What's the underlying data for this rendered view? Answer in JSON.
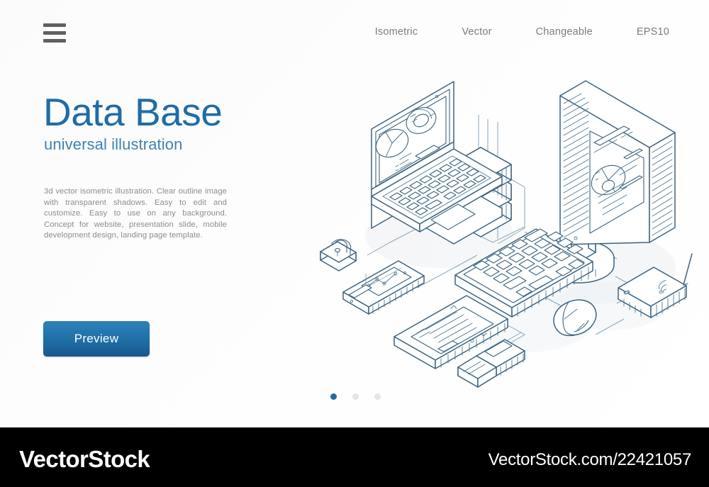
{
  "nav": {
    "menu_icon": "hamburger-menu-icon",
    "items": [
      {
        "label": "Isometric"
      },
      {
        "label": "Vector"
      },
      {
        "label": "Changeable"
      },
      {
        "label": "EPS10"
      }
    ]
  },
  "hero": {
    "title": "Data Base",
    "subtitle": "universal illustration",
    "body": "3d vector isometric illustration. Clear outline image with transparent shadows. Easy to edit and customize. Easy to use on any background. Concept for website, presentation slide, mobile development design, landing page template.",
    "cta_label": "Preview"
  },
  "carousel": {
    "dots": [
      {
        "active": true
      },
      {
        "active": false
      },
      {
        "active": false
      }
    ]
  },
  "illustration": {
    "name": "isometric-database-devices-illustration",
    "devices": [
      "server-rack",
      "laptop",
      "desktop-monitor",
      "padlock",
      "smartphone",
      "tablet",
      "keyboard",
      "computer-mouse",
      "wifi-router",
      "usb-flash-drive"
    ],
    "line_color": "#3b6party",
    "stroke": "#3c6480",
    "shadow": "#eef1f3"
  },
  "footer": {
    "brand": "VectorStock",
    "watermark": "VectorStock.com/22421057"
  },
  "colors": {
    "accent": "#1f6ca6",
    "subtitle": "#3f82b3",
    "body_text": "#8d8d8d",
    "nav_text": "#7c7c7c",
    "footer_bg": "#000000",
    "line": "#3c6480"
  }
}
